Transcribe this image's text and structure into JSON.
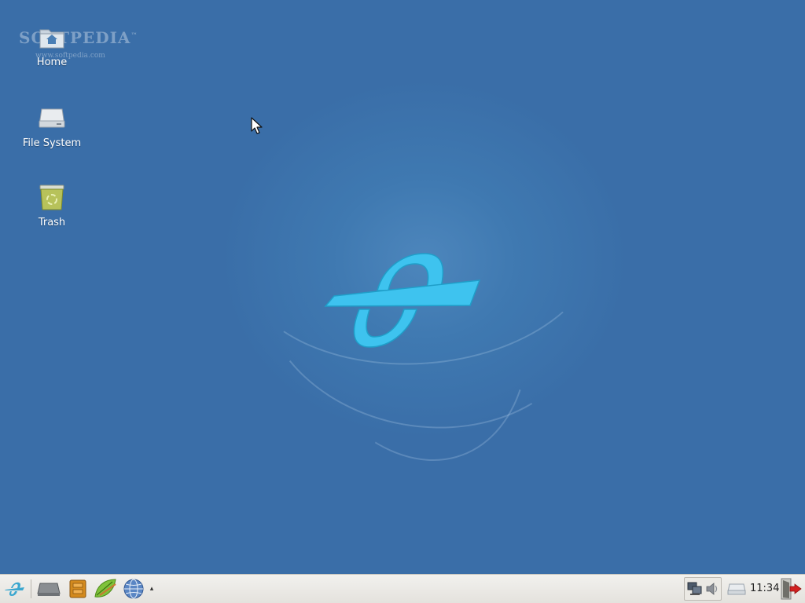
{
  "watermark": {
    "title": "SOFTPEDIA",
    "trademark": "™",
    "url": "www.softpedia.com"
  },
  "desktop_icons": [
    {
      "label": "Home",
      "icon": "home-folder-icon"
    },
    {
      "label": "File System",
      "icon": "drive-icon"
    },
    {
      "label": "Trash",
      "icon": "trash-icon"
    }
  ],
  "taskbar": {
    "launchers": [
      {
        "icon": "xfce-menu-icon"
      },
      {
        "icon": "show-desktop-icon"
      },
      {
        "icon": "file-manager-icon"
      },
      {
        "icon": "text-editor-icon"
      },
      {
        "icon": "web-browser-icon"
      }
    ],
    "launcher_overflow_glyph": "▴",
    "tray": [
      {
        "icon": "network-icon"
      },
      {
        "icon": "volume-icon"
      }
    ],
    "clock": "11:34",
    "logout_icon": "logout-icon"
  },
  "colors": {
    "desktop": "#3a6ea8",
    "logo": "#3ec3ef",
    "taskbar": "#ecebe7"
  }
}
